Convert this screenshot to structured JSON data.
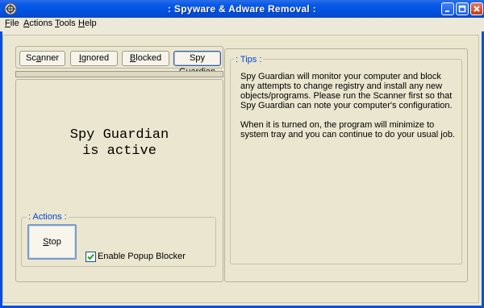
{
  "window": {
    "title": ": Spyware & Adware Removal :"
  },
  "menubar": {
    "items": [
      {
        "accel": "F",
        "rest": "ile"
      },
      {
        "accel": "A",
        "rest": "ctions"
      },
      {
        "accel": "T",
        "rest": "ools"
      },
      {
        "accel": "H",
        "rest": "elp"
      }
    ]
  },
  "tabs": [
    {
      "pre": "Sc",
      "accel": "a",
      "post": "nner",
      "active": false
    },
    {
      "pre": "",
      "accel": "I",
      "post": "gnored",
      "active": false
    },
    {
      "pre": "",
      "accel": "B",
      "post": "locked",
      "active": false
    },
    {
      "pre": "Spy ",
      "accel": "G",
      "post": "uardian",
      "active": true
    }
  ],
  "status": {
    "line1": "Spy Guardian",
    "line2": "is active"
  },
  "actions": {
    "group_label": ": Actions :",
    "stop_accel": "S",
    "stop_rest": "top",
    "popup_blocker_label": "Enable Popup Blocker",
    "popup_blocker_checked": true
  },
  "tips": {
    "group_label": ": Tips :",
    "paragraph1": "Spy Guardian will monitor your computer and block any attempts to change registry and install any new objects/programs. Please run the Scanner first so that Spy Guardian can note your computer's configuration.",
    "paragraph2": "When it is turned on, the program will minimize to system tray and you can continue to do your usual job."
  },
  "colors": {
    "titlebar": "#0a5ae9",
    "window_bg": "#ece9d8",
    "group_label": "#0046d5"
  }
}
